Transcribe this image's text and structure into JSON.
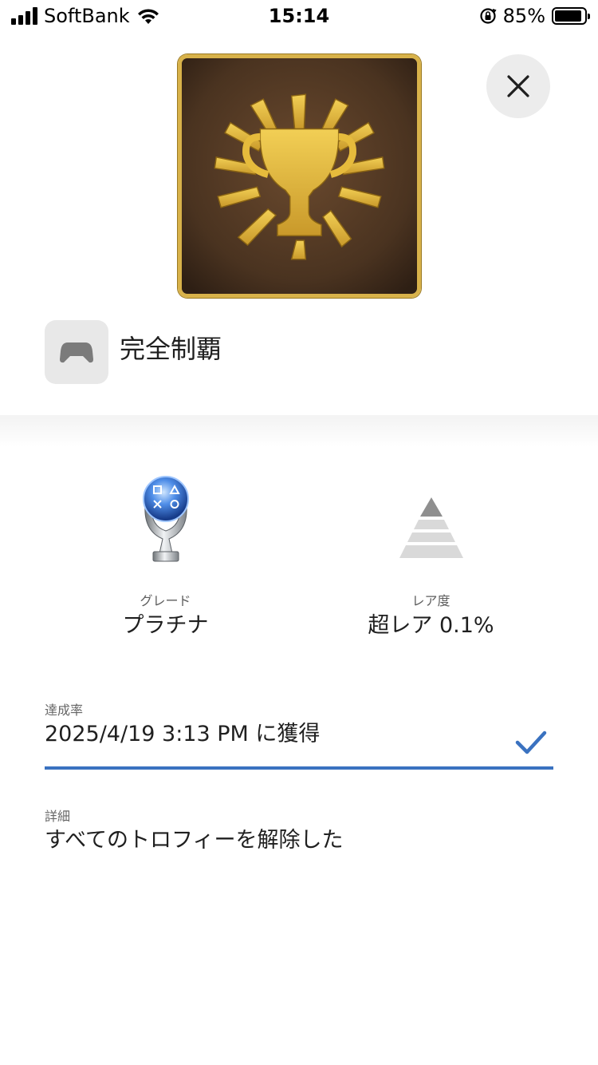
{
  "status_bar": {
    "carrier": "SoftBank",
    "time": "15:14",
    "battery_percent": "85%",
    "battery_level": 0.85,
    "icons": [
      "cellular-signal-icon",
      "wifi-icon",
      "orientation-lock-icon",
      "battery-icon"
    ]
  },
  "trophy": {
    "name": "完全制覇",
    "grade_label": "グレード",
    "grade_value": "プラチナ",
    "rarity_label": "レア度",
    "rarity_value": "超レア 0.1%",
    "earned_label": "達成率",
    "earned_value": "2025/4/19  3:13 PM に獲得",
    "detail_label": "詳細",
    "detail_value": "すべてのトロフィーを解除した"
  },
  "icons": {
    "close": "close-icon",
    "game": "gamepad-icon",
    "grade": "platinum-trophy-icon",
    "rarity": "rarity-pyramid-icon",
    "earned": "checkmark-icon"
  },
  "colors": {
    "accent": "#3a72c0",
    "trophy_gold": "#e6bb3c",
    "trophy_bg": "#4a3320"
  }
}
